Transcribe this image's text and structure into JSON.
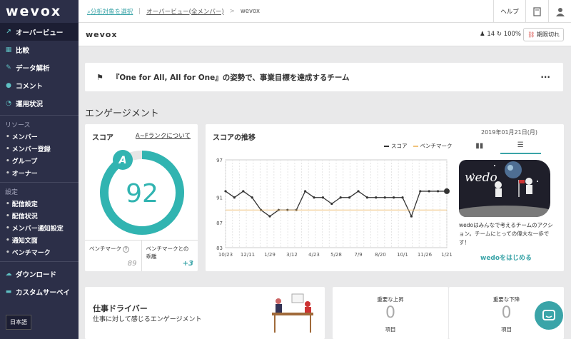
{
  "brand": {
    "logo": "wevox"
  },
  "sidebar": {
    "items": [
      {
        "label": "オーバービュー",
        "icon": "trend-icon"
      },
      {
        "label": "比較",
        "icon": "grid-icon"
      },
      {
        "label": "データ解析",
        "icon": "analysis-icon"
      },
      {
        "label": "コメント",
        "icon": "comment-icon"
      },
      {
        "label": "運用状況",
        "icon": "gauge-icon"
      }
    ],
    "resources_title": "リソース",
    "resources": [
      "メンバー",
      "メンバー登録",
      "グループ",
      "オーナー"
    ],
    "settings_title": "設定",
    "settings": [
      "配信設定",
      "配信状況",
      "メンバー通知設定",
      "通知文面",
      "ベンチマーク"
    ],
    "bottom": [
      {
        "label": "ダウンロード",
        "icon": "cloud-icon"
      },
      {
        "label": "カスタムサーベイ",
        "icon": "folder-icon"
      }
    ],
    "lang": "日本語"
  },
  "topbar": {
    "select_target": "分析対象を選択",
    "crumb1": "オーバービュー(全メンバー)",
    "sep": ">",
    "crumb2": "wevox",
    "help": "ヘルプ"
  },
  "subbar": {
    "title": "wevox",
    "member_count": "14",
    "rate": "100%",
    "expire": "期限切れ"
  },
  "goal": {
    "text": "『One for All, All for One』の姿勢で、事業目標を達成するチーム",
    "more": "···"
  },
  "engagement": {
    "title": "エンゲージメント"
  },
  "score_card": {
    "title": "スコア",
    "rank_link": "A~Fランクについて",
    "rank": "A",
    "score": "92",
    "score_pct": 0.92,
    "benchmark_label": "ベンチマーク",
    "benchmark_help": "?",
    "benchmark_value": "89",
    "gap_label": "ベンチマークとの乖離",
    "gap_value": "+3"
  },
  "trend_card": {
    "title": "スコアの推移",
    "legend_score": "スコア",
    "legend_bench": "ベンチマーク",
    "date": "2019年01月21日(月)"
  },
  "wedo": {
    "text": "wedoはみんなで考えるチームのアクション。チームにとっての偉大な一歩です！",
    "button": "wedoをはじめる",
    "img_text": "wedo"
  },
  "drivers": {
    "title": "仕事ドライバー",
    "subtitle": "仕事に対して感じるエンゲージメント"
  },
  "rise": {
    "title": "重要な上昇",
    "value": "0",
    "unit": "項目"
  },
  "fall": {
    "title": "重要な下降",
    "value": "0",
    "unit": "項目"
  },
  "chart_data": {
    "type": "line",
    "x": [
      "10/23",
      "",
      "",
      "12/11",
      "",
      "",
      "1/29",
      "",
      "",
      "3/12",
      "",
      "",
      "4/23",
      "",
      "5/28",
      "",
      "",
      "7/9",
      "",
      "",
      "8/20",
      "",
      "",
      "10/1",
      "",
      "",
      "",
      "11/26",
      "",
      "",
      "1/21"
    ],
    "xticks": [
      "10/23",
      "12/11",
      "1/29",
      "3/12",
      "4/23",
      "5/28",
      "7/9",
      "8/20",
      "10/1",
      "11/26",
      "1/21"
    ],
    "series": [
      {
        "name": "スコア",
        "color": "#333333",
        "values": [
          92,
          91,
          92,
          91,
          89,
          88,
          89,
          89,
          89,
          92,
          91,
          91,
          90,
          91,
          91,
          92,
          91,
          91,
          91,
          91,
          91,
          88,
          92,
          92,
          92,
          92
        ]
      },
      {
        "name": "ベンチマーク",
        "color": "#f0c27b",
        "values": [
          89,
          89,
          89,
          89,
          89,
          89,
          89,
          89,
          89,
          89,
          89,
          89,
          89,
          89,
          89,
          89,
          89,
          89,
          89,
          89,
          89,
          89,
          89,
          89,
          89,
          89
        ]
      }
    ],
    "yticks": [
      "97",
      "91",
      "87",
      "83"
    ],
    "ylim": [
      83,
      97
    ]
  }
}
